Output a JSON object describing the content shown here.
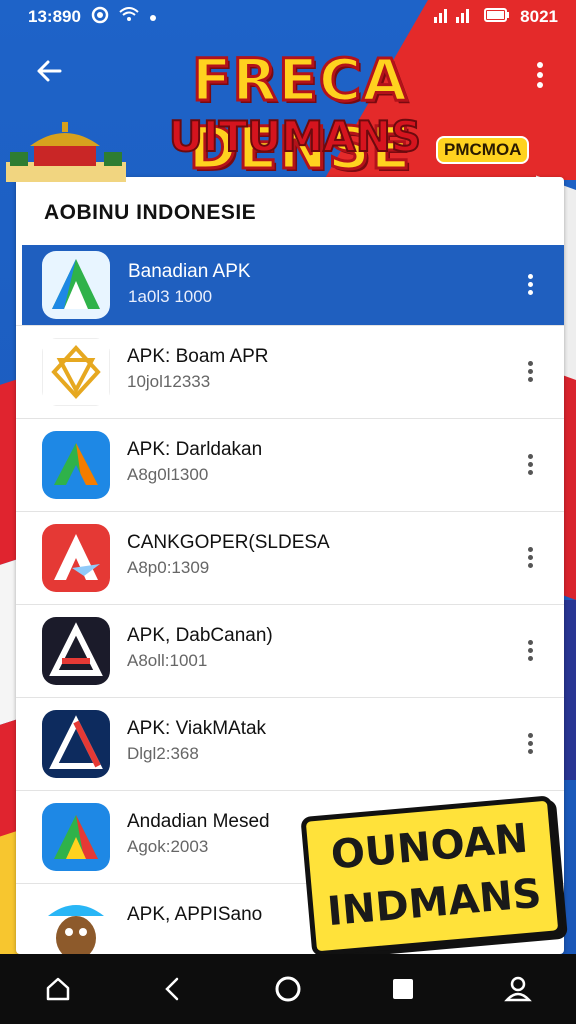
{
  "status_bar": {
    "time": "13:890",
    "battery_text": "8021"
  },
  "header": {
    "title_line1": "FRECA DENSE",
    "title_line2": "UITUMANS",
    "badge": "PMCMOA"
  },
  "card": {
    "section_title": "AOBINU INDONESIE"
  },
  "apps": [
    {
      "name": "Banadian APK",
      "sub": "1a0l3 1000",
      "icon": "green-a-icon",
      "active": true
    },
    {
      "name": "APK: Boam APR",
      "sub": "10jol12333",
      "icon": "gold-star-icon",
      "active": false
    },
    {
      "name": "APK: Darldakan",
      "sub": "A8g0l1300",
      "icon": "blue-tri-icon",
      "active": false
    },
    {
      "name": "CANKGOPER(SLDESA",
      "sub": "A8p0:1309",
      "icon": "red-a-icon",
      "active": false
    },
    {
      "name": "APK, DabCanan)",
      "sub": "A8oll:1001",
      "icon": "dark-a-icon",
      "active": false
    },
    {
      "name": "APK: ViakMAtak",
      "sub": "Dlgl2:368",
      "icon": "navy-a-icon",
      "active": false
    },
    {
      "name": "Andadian Mesed",
      "sub": "Agok:2003",
      "icon": "color-a-icon",
      "active": false
    },
    {
      "name": "APK, APPISano",
      "sub": "",
      "icon": "mascot-icon",
      "active": false
    }
  ],
  "promo": {
    "line1": "OUNOAN",
    "line2": "INDMANS"
  },
  "colors": {
    "accent_blue": "#1f5fbf",
    "brand_red": "#e0242f",
    "brand_yellow": "#ffd21f"
  }
}
